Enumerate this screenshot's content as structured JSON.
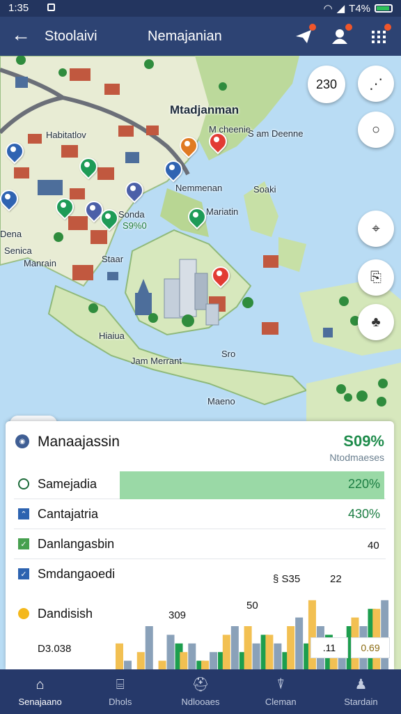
{
  "status_bar": {
    "time": "1:35",
    "battery_text": "T4%"
  },
  "app_bar": {
    "title_left": "Stoolaivi",
    "title_center": "Nemajanian"
  },
  "map": {
    "count_badge": "230",
    "labels": {
      "main": "Mtadjanman",
      "habitat": "Habitatlov",
      "mcreen": "M cheenie",
      "sam_deen": "S am Deenne",
      "nemmenan": "Nemmenan",
      "soaki": "Soaki",
      "sonda": "Sonda",
      "sqk": "S9%0",
      "mariatin": "Mariatin",
      "dena": "Dena",
      "senica": "Senica",
      "manorin": "Manrain",
      "staar": "Staar",
      "hiaiua": "Hiaiua",
      "jam_merrant": "Jam Merrant",
      "sro": "Sro",
      "maeno": "Maeno"
    }
  },
  "panel": {
    "title": "Manaajassin",
    "percent": "S09%",
    "subtitle": "Ntodmaeses",
    "rows": [
      {
        "label": "Samejadia",
        "value": "220%",
        "fill": 0.71
      },
      {
        "label": "Cantajatria",
        "value": "430%",
        "fill": 0
      },
      {
        "label": "Danlangasbin",
        "value": "",
        "fill": 0
      },
      {
        "label": "Smdangaoedi",
        "value": "",
        "fill": 0
      },
      {
        "label": "Dandisish",
        "value": "",
        "fill": 0
      }
    ],
    "chart": {
      "labels": {
        "a": "D3.038",
        "b": "309",
        "c": "§ S35",
        "d": "22",
        "e": "40",
        "f": "50",
        "g": ".11",
        "h": "0.69"
      }
    }
  },
  "chart_data": {
    "type": "bar",
    "series": [
      {
        "values": [
          3,
          2,
          1,
          2,
          1,
          4,
          5,
          4,
          5,
          8,
          3,
          6,
          7
        ]
      },
      {
        "values": [
          1,
          5,
          4,
          3,
          2,
          5,
          3,
          3,
          6,
          5,
          3,
          5,
          8
        ]
      },
      {
        "values": [
          0,
          0,
          3,
          1,
          2,
          2,
          4,
          2,
          3,
          4,
          5,
          7,
          9
        ]
      }
    ]
  },
  "nav": {
    "items": [
      {
        "label": "Senajaano",
        "icon": "home-icon"
      },
      {
        "label": "Dhols",
        "icon": "building-icon"
      },
      {
        "label": "Ndlooaes",
        "icon": "helmet-icon"
      },
      {
        "label": "Cleman",
        "icon": "tower-icon"
      },
      {
        "label": "Stardain",
        "icon": "team-icon"
      }
    ]
  }
}
